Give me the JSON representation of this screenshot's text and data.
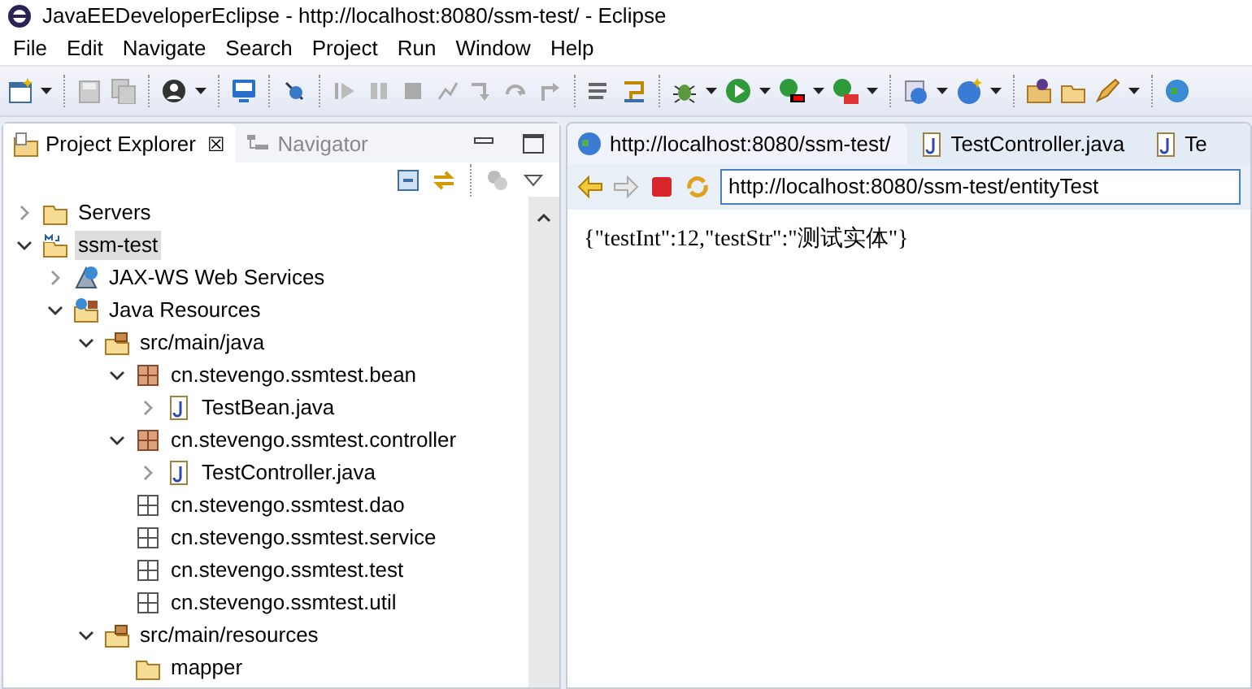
{
  "window": {
    "title": "JavaEEDeveloperEclipse - http://localhost:8080/ssm-test/ - Eclipse"
  },
  "menu": [
    "File",
    "Edit",
    "Navigate",
    "Search",
    "Project",
    "Run",
    "Window",
    "Help"
  ],
  "left_tabs": [
    {
      "label": "Project Explorer",
      "selected": true,
      "close": "☒"
    },
    {
      "label": "Navigator",
      "selected": false
    }
  ],
  "tree": [
    {
      "label": "Servers",
      "kind": "folder",
      "expanded": false,
      "selected": false
    },
    {
      "label": "ssm-test",
      "kind": "project",
      "expanded": true,
      "selected": true,
      "children": [
        {
          "label": "JAX-WS Web Services",
          "kind": "webservices",
          "expanded": false,
          "selected": false
        },
        {
          "label": "Java Resources",
          "kind": "javares",
          "expanded": true,
          "selected": false,
          "children": [
            {
              "label": "src/main/java",
              "kind": "srcfolder",
              "expanded": true,
              "selected": false,
              "children": [
                {
                  "label": "cn.stevengo.ssmtest.bean",
                  "kind": "package",
                  "expanded": true,
                  "selected": false,
                  "children": [
                    {
                      "label": "TestBean.java",
                      "kind": "javafile",
                      "expanded": false,
                      "selected": false
                    }
                  ]
                },
                {
                  "label": "cn.stevengo.ssmtest.controller",
                  "kind": "package",
                  "expanded": true,
                  "selected": false,
                  "children": [
                    {
                      "label": "TestController.java",
                      "kind": "javafile",
                      "expanded": false,
                      "selected": false
                    }
                  ]
                },
                {
                  "label": "cn.stevengo.ssmtest.dao",
                  "kind": "emptypackage",
                  "selected": false
                },
                {
                  "label": "cn.stevengo.ssmtest.service",
                  "kind": "emptypackage",
                  "selected": false
                },
                {
                  "label": "cn.stevengo.ssmtest.test",
                  "kind": "emptypackage",
                  "selected": false
                },
                {
                  "label": "cn.stevengo.ssmtest.util",
                  "kind": "emptypackage",
                  "selected": false
                }
              ]
            },
            {
              "label": "src/main/resources",
              "kind": "srcfolder",
              "expanded": true,
              "selected": false,
              "children": [
                {
                  "label": "mapper",
                  "kind": "folder",
                  "selected": false
                }
              ]
            }
          ]
        }
      ]
    }
  ],
  "editor_tabs": [
    {
      "label": "http://localhost:8080/ssm-test/",
      "kind": "browser",
      "selected": true
    },
    {
      "label": "TestController.java",
      "kind": "java",
      "selected": false
    },
    {
      "label": "Te",
      "kind": "java",
      "selected": false
    }
  ],
  "browser": {
    "url": "http://localhost:8080/ssm-test/entityTest",
    "content": "{\"testInt\":12,\"testStr\":\"测试实体\"}"
  }
}
